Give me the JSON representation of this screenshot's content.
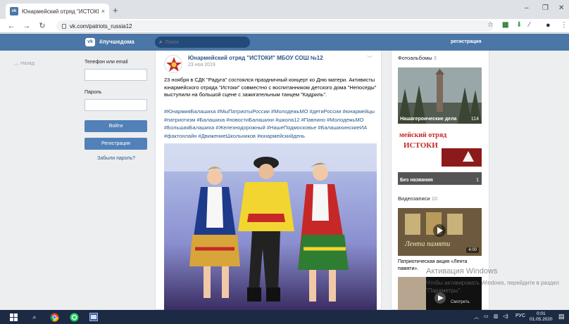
{
  "browser": {
    "tab_title": "Юнармейский отряд \"ИСТОКИ",
    "tab_close": "×",
    "new_tab": "+",
    "url": "vk.com/patriots_russia12",
    "win_min": "–",
    "win_max": "❐",
    "win_close": "✕"
  },
  "vk_header": {
    "logo": "vk",
    "hashtag": "#лучшедома",
    "search_placeholder": "Поиск",
    "register": "регистрация"
  },
  "left": {
    "back": "Назад",
    "phone_label": "Телефон или email",
    "password_label": "Пароль",
    "login_button": "Войти",
    "register_button": "Регистрация",
    "forgot": "Забыли пароль?"
  },
  "post": {
    "author": "Юнармейский отряд \"ИСТОКИ\" МБОУ СОШ №12",
    "date": "23 ноя 2019",
    "text": "23 ноября в СДК \"Радуга\" состоялся праздничный концерт ко Дню матери. Активисты юнармейского отряда \"Истоки\" совместно с воспитанником детского дома \"Непоседы\" выступили на большой сцене с зажигательным танцем \"Кадриль\".",
    "hashtags": "#ЮнармияБалашиха #МыПатриотыРоссии #МолодежьМО #детиРоссии #юнармейцы #патриотизм #Балашиха #новостиБалашихи #школа12 #Павлино #МолодежьМО #БольшаяБалашиха #Железнодорожный #НашеПодмосковье #БалашихинскиеИА #фактонлайн #ДвижениеШкольников #юнармейскийдень"
  },
  "right": {
    "albums_title": "Фотоальбомы",
    "albums_count": "3",
    "album1_caption": "Нашагероические дела",
    "album1_count": "114",
    "album2_banner": "мейский отряд",
    "album2_banner2": "ИСТОКИ",
    "album2_caption": "Без названия",
    "album2_count": "1",
    "videos_title": "Видеозаписи",
    "videos_count": "10",
    "video1_duration": "4:00",
    "video1_overlay": "Лента памяти",
    "video1_title": "Патриотическая акция «Лента памяти».",
    "video2_overlay": "Смотреть"
  },
  "watermark": {
    "line1": "Активация Windows",
    "line2": "Чтобы активировать Windows, перейдите в раздел \"Параметры\"."
  },
  "taskbar": {
    "lang": "РУС",
    "time": "0:01",
    "date": "01.05.2020"
  },
  "colors": {
    "vk_blue": "#4a76a8",
    "vk_link": "#2a5885",
    "button": "#5181b8",
    "taskbar": "#1c2a44"
  }
}
